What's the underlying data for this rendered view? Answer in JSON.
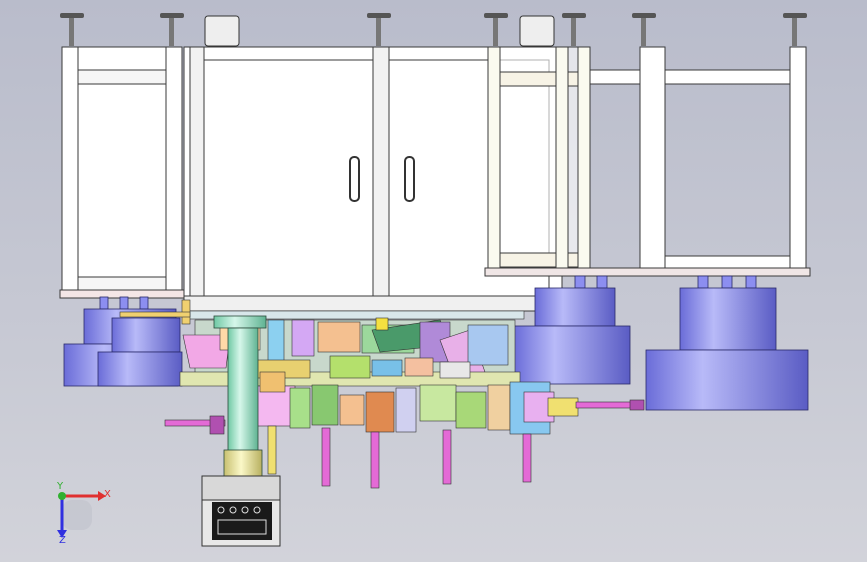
{
  "viewport": {
    "background_top": "#b9bccb",
    "background_bottom": "#d2d3da"
  },
  "model": {
    "frame_color": "#ffffff",
    "frame_stroke": "#3a3a3a",
    "cylinder_color": "#8c8ef0",
    "column_color": "#9fe3c8",
    "magenta_parts": "#e46ad6",
    "yellow_parts": "#f4f0a0",
    "green_parts": "#a6e08a"
  },
  "triad": {
    "x_label": "X",
    "y_label": "Y",
    "z_label": "Z",
    "x_color": "#e03030",
    "y_color": "#30b030",
    "z_color": "#3030e0"
  }
}
